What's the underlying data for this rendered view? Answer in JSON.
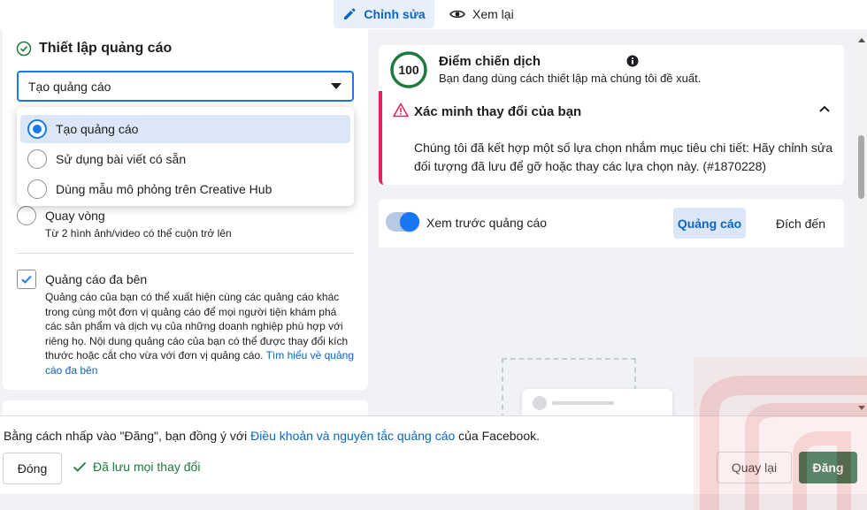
{
  "top_tabs": {
    "edit_label": "Chỉnh sửa",
    "review_label": "Xem lại"
  },
  "ad_setup": {
    "title": "Thiết lập quảng cáo",
    "select_value": "Tạo quảng cáo",
    "options": [
      {
        "label": "Tạo quảng cáo",
        "selected": true
      },
      {
        "label": "Sử dụng bài viết có sẵn",
        "selected": false
      },
      {
        "label": "Dùng mẫu mô phỏng trên Creative Hub",
        "selected": false
      }
    ],
    "carousel": {
      "label": "Quay vòng",
      "sub": "Từ 2 hình ảnh/video có thể cuộn trở lên"
    },
    "multi_advertiser": {
      "label": "Quảng cáo đa bên",
      "checked": true,
      "description": "Quảng cáo của bạn có thể xuất hiện cùng các quảng cáo khác trong cùng một đơn vị quảng cáo để mọi người tiện khám phá các sản phẩm và dịch vụ của những doanh nghiệp phù hợp với riêng họ. Nội dung quảng cáo của bạn có thể được thay đổi kích thước hoặc cắt cho vừa với đơn vị quảng cáo.",
      "link": "Tìm hiểu về quảng cáo đa bên"
    }
  },
  "campaign_score": {
    "score": "100",
    "title": "Điểm chiến dịch",
    "subtitle": "Bạn đang dùng cách thiết lập mà chúng tôi đề xuất."
  },
  "verify": {
    "title": "Xác minh thay đổi của bạn",
    "body": "Chúng tôi đã kết hợp một số lựa chọn nhắm mục tiêu chi tiết: Hãy chỉnh sửa đối tượng đã lưu để gỡ hoặc thay các lựa chọn này. (#1870228)"
  },
  "preview": {
    "toggle_label": "Xem trước quảng cáo",
    "toggle_on": true,
    "tab_ad": "Quảng cáo",
    "tab_destination": "Đích đến"
  },
  "footer": {
    "terms_prefix": "Bằng cách nhấp vào \"Đăng\", bạn đồng ý với ",
    "terms_link": "Điều khoản và nguyên tắc quảng cáo",
    "terms_suffix": " của Facebook.",
    "close_label": "Đóng",
    "saved_label": "Đã lưu mọi thay đổi",
    "back_label": "Quay lại",
    "publish_label": "Đăng"
  },
  "colors": {
    "accent": "#1877f2",
    "link": "#0a66c2",
    "publish": "#1e6b44",
    "warning": "#e0245e",
    "score_ring": "#1e7a3c"
  }
}
